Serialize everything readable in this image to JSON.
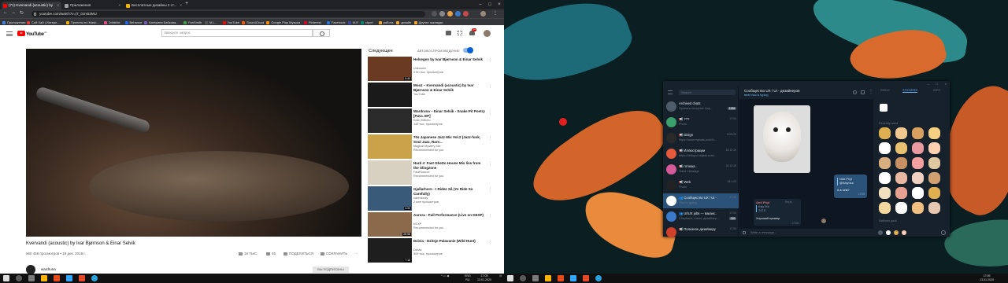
{
  "browser": {
    "tabs": [
      {
        "label": "(71) Kvervandi (acoustic) by",
        "color": "#ff0000"
      },
      {
        "label": "Приложения",
        "color": "#9e9e9e"
      },
      {
        "label": "Бесплатные дизайны 2 ст...",
        "color": "#f4b400"
      }
    ],
    "url": "youtube.com/watch?v=jT_0Jrx53MU",
    "bookmarks": [
      {
        "label": "Приложения",
        "color": "#4285f4"
      },
      {
        "label": "Сой Хай | Интерн...",
        "color": "#e53935"
      },
      {
        "label": "Проекты по Mash...",
        "color": "#f4b400"
      },
      {
        "label": "Dribbble",
        "color": "#ea4c89"
      },
      {
        "label": "Behance",
        "color": "#1769ff"
      },
      {
        "label": "Катерина Бабкова...",
        "color": "#7e57c2"
      },
      {
        "label": "FanSmith",
        "color": "#43a047"
      },
      {
        "label": "M.L...",
        "color": "#555555"
      },
      {
        "label": "YouTube",
        "color": "#ff0000"
      },
      {
        "label": "SoundCloud",
        "color": "#ff5500"
      },
      {
        "label": "Google Play Музыка",
        "color": "#ff8f00"
      },
      {
        "label": "Pinterest",
        "color": "#e60023"
      },
      {
        "label": "Facebook",
        "color": "#1877f2"
      },
      {
        "label": "M.R",
        "color": "#3949ab"
      },
      {
        "label": "clpcrt",
        "color": "#00897b"
      },
      {
        "label": "работа",
        "color": "#f9a825"
      },
      {
        "label": "дизайн",
        "color": "#f9a825"
      },
      {
        "label": "Другие закладки",
        "color": "#f9a825"
      }
    ]
  },
  "youtube": {
    "brand": "YouTube",
    "brand_sup": "UA",
    "search_placeholder": "Введите запрос",
    "notification_count": "9+",
    "video_title": "Kvervandi (acoustic) by Ivar Bjørnson & Einar Selvik",
    "video_meta": "560 466 просмотров • 18 дек. 2018 г.",
    "actions": {
      "like": "18 ТЫС.",
      "dislike": "46",
      "share": "ПОДЕЛИТЬСЯ",
      "save": "СОХРАНИТЬ"
    },
    "channel": "wardruna",
    "subscribed": "ВЫ ПОДПИСАНЫ",
    "up_next": "Следующее",
    "autoplay": "АВТОВОСПРОИЗВЕДЕНИЕ",
    "recommendations": [
      {
        "title": "Helvegen by Ivar Bjørnson & Einar Selvik",
        "channel": "Unknown",
        "views": "2 бн тыс. просмотров",
        "duration": "5:40",
        "thumb": "#6b3a22"
      },
      {
        "title": "Mooz – Kvervandi (acoustic) by Ivar Bjørnson & Einar Selvik",
        "channel": "YouTube",
        "views": "",
        "duration": "",
        "thumb": "#1a1a1a"
      },
      {
        "title": "Wardruna – Einar Selvik - Snake Pit Poetry [FULL EP]",
        "channel": "Koko Kl8nno",
        "views": "149 тыс. просмотров",
        "duration": "",
        "thumb": "#2a2a2a"
      },
      {
        "title": "70s Japanese Jazz Mix Vol.2 (Jazz-funk, Soul Jazz, Rare...",
        "channel": "Magical Mystery Mix",
        "views": "Recommended for you",
        "duration": "",
        "thumb": "#c9a24a"
      },
      {
        "title": "Hard n' Fast Ghetto House Mix live from the Slingzone",
        "channel": "FaultSource",
        "views": "Recommended for you",
        "duration": "",
        "thumb": "#d8d0c0"
      },
      {
        "title": "Gjallarhorn - I Ridee Så (Ye Ride So Carefully)",
        "channel": "rottenlocky",
        "views": "2 млн просмотров",
        "duration": "4:34",
        "thumb": "#3a5a7a"
      },
      {
        "title": "Aurora - Full Performance (Live on KEXP)",
        "channel": "KEXP",
        "views": "Recommended for you",
        "duration": "28:58",
        "thumb": "#8a6a4a"
      },
      {
        "title": "Dzivia - Dzitsje Palavanie (Wild Hunt)",
        "channel": "Dzivia",
        "views": "309 тыс. просмотров",
        "duration": "7:16",
        "thumb": "#1e1e1e"
      }
    ]
  },
  "telegram": {
    "search_placeholder": "Search",
    "chats": [
      {
        "name": "Archived chats",
        "msg": "Проекты на кухне: Кар...",
        "time": "",
        "badge": "1984",
        "color": "#4f5d6a"
      },
      {
        "name": "📢 ???",
        "msg": "Photo",
        "time": "17:04",
        "badge": "",
        "color": "#3a9f6a"
      },
      {
        "name": "📢 Dizign",
        "msg": "https://www.mybots.com/N...",
        "time": "6:05:20",
        "badge": "",
        "color": "#2a2a2a"
      },
      {
        "name": "📢 Иллюстрации",
        "msg": "https://designo.digital.com/...",
        "time": "16:12:19",
        "badge": "",
        "color": "#e55a3a"
      },
      {
        "name": "📢 готовка",
        "msg": "Voice message",
        "time": "16:12:19",
        "badge": "",
        "color": "#d65a9a"
      },
      {
        "name": "📢 Web",
        "msg": "Photo",
        "time": "16:1:20",
        "badge": "",
        "color": "#222222"
      },
      {
        "name": "👥 Сообщество UX / UI -...",
        "msg": "Vlad is typing",
        "time": "17:05",
        "badge": "",
        "color": "#ffffff"
      },
      {
        "name": "👥 UI/UX jobs — ваканс...",
        "msg": "Сберbank: Intern, дизайнер...",
        "time": "17:04",
        "badge": "249",
        "color": "#3a7ac9"
      },
      {
        "name": "📢 Полезное дизайнеру",
        "msg": "",
        "time": "17:04",
        "badge": "",
        "color": "#d0402a"
      }
    ],
    "header_title": "Сообщество UX / UI - дизайнеров",
    "header_status": "●●● Vlad is typing",
    "reply": {
      "author": "Nick Phyl",
      "text": "@Katyrica",
      "body": "А в чем?",
      "time": "17:05"
    },
    "message": {
      "author": "Anti Phyl",
      "reply_to": "Katy Erie",
      "reply_text": "Э-Е-Е",
      "text": "Хороший пример",
      "time": "17:05",
      "reply_label": "Reply"
    },
    "input_placeholder": "Write a message...",
    "emoji_tabs": [
      "EMOJI",
      "STICKERS",
      "GIFS"
    ],
    "recently_used": "Recently used",
    "pack_name": "Nathwei pack"
  },
  "taskbar": {
    "lang": "ENG",
    "region": "RU",
    "time_left": "17:05",
    "date_left": "13.01.2020",
    "time_right": "17:05",
    "date_right": "13.01.2020"
  }
}
